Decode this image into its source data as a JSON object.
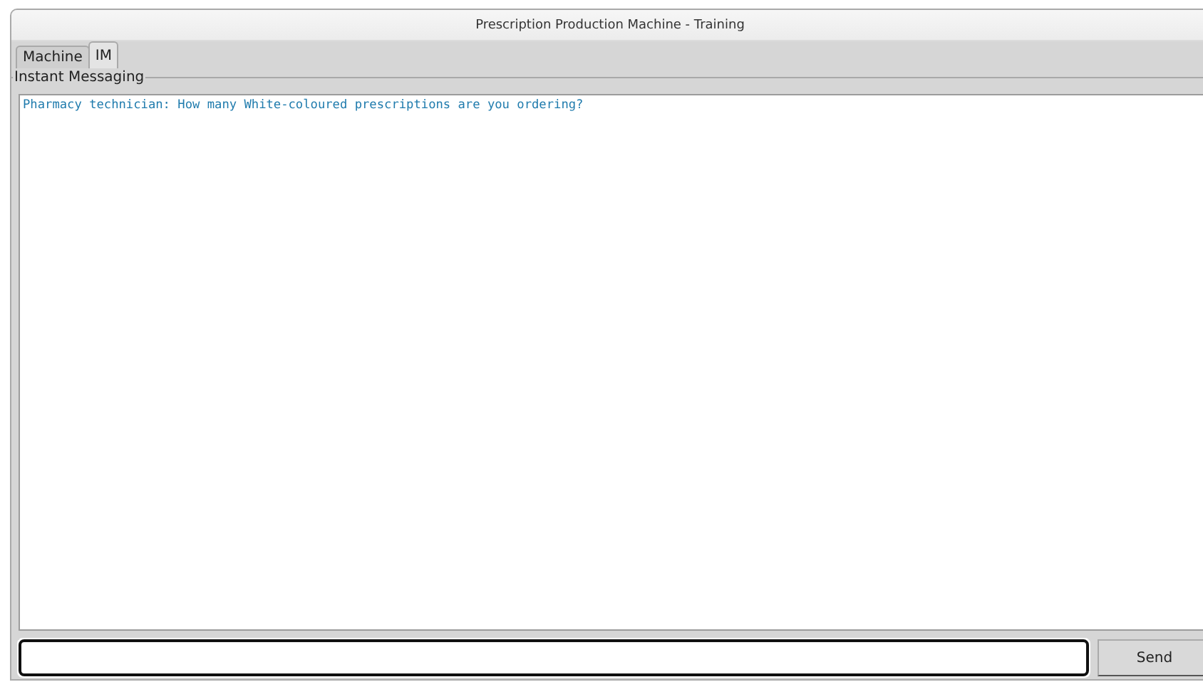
{
  "window": {
    "title": "Prescription Production Machine - Training"
  },
  "tabs": [
    {
      "label": "Machine",
      "selected": false
    },
    {
      "label": "IM",
      "selected": true
    }
  ],
  "group": {
    "title": "Instant Messaging"
  },
  "messages": [
    {
      "text": "Pharmacy technician: How many White-coloured prescriptions are you ordering?"
    }
  ],
  "send_button": {
    "label": "Send"
  }
}
